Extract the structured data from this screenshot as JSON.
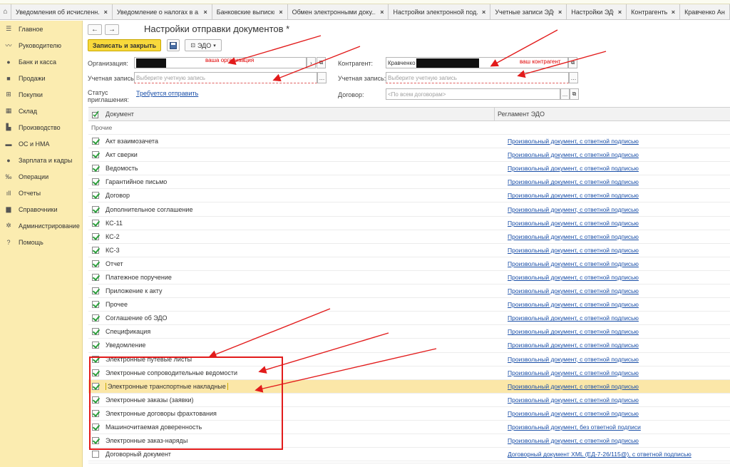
{
  "tabs": [
    {
      "label": "Уведомления об исчисленн..."
    },
    {
      "label": "Уведомление о налогах в а..."
    },
    {
      "label": "Банковские выписки"
    },
    {
      "label": "Обмен электронными доку..."
    },
    {
      "label": "Настройки электронной под..."
    },
    {
      "label": "Учетные записи ЭДО"
    },
    {
      "label": "Настройки ЭДО"
    },
    {
      "label": "Контрагенты"
    },
    {
      "label": "Кравченко Андр"
    }
  ],
  "sidebar": {
    "items": [
      {
        "label": "Главное",
        "icon": "menu-icon"
      },
      {
        "label": "Руководителю",
        "icon": "trend-icon"
      },
      {
        "label": "Банк и касса",
        "icon": "coin-icon"
      },
      {
        "label": "Продажи",
        "icon": "bag-icon"
      },
      {
        "label": "Покупки",
        "icon": "cart-icon"
      },
      {
        "label": "Склад",
        "icon": "warehouse-icon"
      },
      {
        "label": "Производство",
        "icon": "factory-icon"
      },
      {
        "label": "ОС и НМА",
        "icon": "truck-icon"
      },
      {
        "label": "Зарплата и кадры",
        "icon": "person-icon"
      },
      {
        "label": "Операции",
        "icon": "operations-icon"
      },
      {
        "label": "Отчеты",
        "icon": "bar-chart-icon"
      },
      {
        "label": "Справочники",
        "icon": "book-icon"
      },
      {
        "label": "Администрирование",
        "icon": "gear-icon"
      },
      {
        "label": "Помощь",
        "icon": "help-icon"
      }
    ]
  },
  "header": {
    "back": "←",
    "forward": "→",
    "title": "Настройки отправки документов *"
  },
  "toolbar": {
    "save_close": "Записать и закрыть",
    "edo": "ЭДО"
  },
  "form": {
    "org_label": "Организация:",
    "org_note": "ваша организация",
    "counterparty_label": "Контрагент:",
    "counterparty_value": "Кравченко",
    "counterparty_note": "ваш контрагент",
    "account_label_left": "Учетная запись:",
    "account_placeholder_left": "Выберите учетную запись",
    "account_label_right": "Учетная запись:",
    "account_placeholder_right": "Выберите учетную запись",
    "status_label": "Статус приглашения:",
    "status_link": "Требуется отправить",
    "contract_label": "Договор:",
    "contract_placeholder": "<По всем договорам>"
  },
  "table": {
    "col_document": "Документ",
    "col_regulation": "Регламент ЭДО",
    "group": "Прочие",
    "rows": [
      {
        "doc": "Акт взаимозачета",
        "reg": "Произвольный документ, с ответной подписью",
        "checked": true
      },
      {
        "doc": "Акт сверки",
        "reg": "Произвольный документ, с ответной подписью",
        "checked": true
      },
      {
        "doc": "Ведомость",
        "reg": "Произвольный документ, с ответной подписью",
        "checked": true
      },
      {
        "doc": "Гарантийное письмо",
        "reg": "Произвольный документ, с ответной подписью",
        "checked": true
      },
      {
        "doc": "Договор",
        "reg": "Произвольный документ, с ответной подписью",
        "checked": true
      },
      {
        "doc": "Дополнительное соглашение",
        "reg": "Произвольный документ, с ответной подписью",
        "checked": true
      },
      {
        "doc": "КС-11",
        "reg": "Произвольный документ, с ответной подписью",
        "checked": true
      },
      {
        "doc": "КС-2",
        "reg": "Произвольный документ, с ответной подписью",
        "checked": true
      },
      {
        "doc": "КС-3",
        "reg": "Произвольный документ, с ответной подписью",
        "checked": true
      },
      {
        "doc": "Отчет",
        "reg": "Произвольный документ, с ответной подписью",
        "checked": true
      },
      {
        "doc": "Платежное поручение",
        "reg": "Произвольный документ, с ответной подписью",
        "checked": true
      },
      {
        "doc": "Приложение к акту",
        "reg": "Произвольный документ, с ответной подписью",
        "checked": true
      },
      {
        "doc": "Прочее",
        "reg": "Произвольный документ, с ответной подписью",
        "checked": true
      },
      {
        "doc": "Соглашение об ЭДО",
        "reg": "Произвольный документ, с ответной подписью",
        "checked": true
      },
      {
        "doc": "Спецификация",
        "reg": "Произвольный документ, с ответной подписью",
        "checked": true
      },
      {
        "doc": "Уведомление",
        "reg": "Произвольный документ, с ответной подписью",
        "checked": true
      },
      {
        "doc": "Электронные путевые листы",
        "reg": "Произвольный документ, с ответной подписью",
        "checked": true
      },
      {
        "doc": "Электронные сопроводительные ведомости",
        "reg": "Произвольный документ, с ответной подписью",
        "checked": true
      },
      {
        "doc": "Электронные транспортные накладные",
        "reg": "Произвольный документ, с ответной подписью",
        "checked": true,
        "selected": true
      },
      {
        "doc": "Электронные заказы (заявки)",
        "reg": "Произвольный документ, с ответной подписью",
        "checked": true
      },
      {
        "doc": "Электронные договоры фрахтования",
        "reg": "Произвольный документ, с ответной подписью",
        "checked": true
      },
      {
        "doc": "Машиночитаемая доверенность",
        "reg": "Произвольный документ, без ответной подписи",
        "checked": true
      },
      {
        "doc": "Электронные заказ-наряды",
        "reg": "Произвольный документ, с ответной подписью",
        "checked": true
      },
      {
        "doc": "Договорный документ",
        "reg": "Договорный документ XML (ЕД-7-26/115@), с ответной подписью",
        "checked": false
      }
    ]
  },
  "colors": {
    "accent": "#f8d93c",
    "sidebar": "#fbecb0",
    "annotation": "#e21b1b",
    "link": "#1a4fa8"
  }
}
